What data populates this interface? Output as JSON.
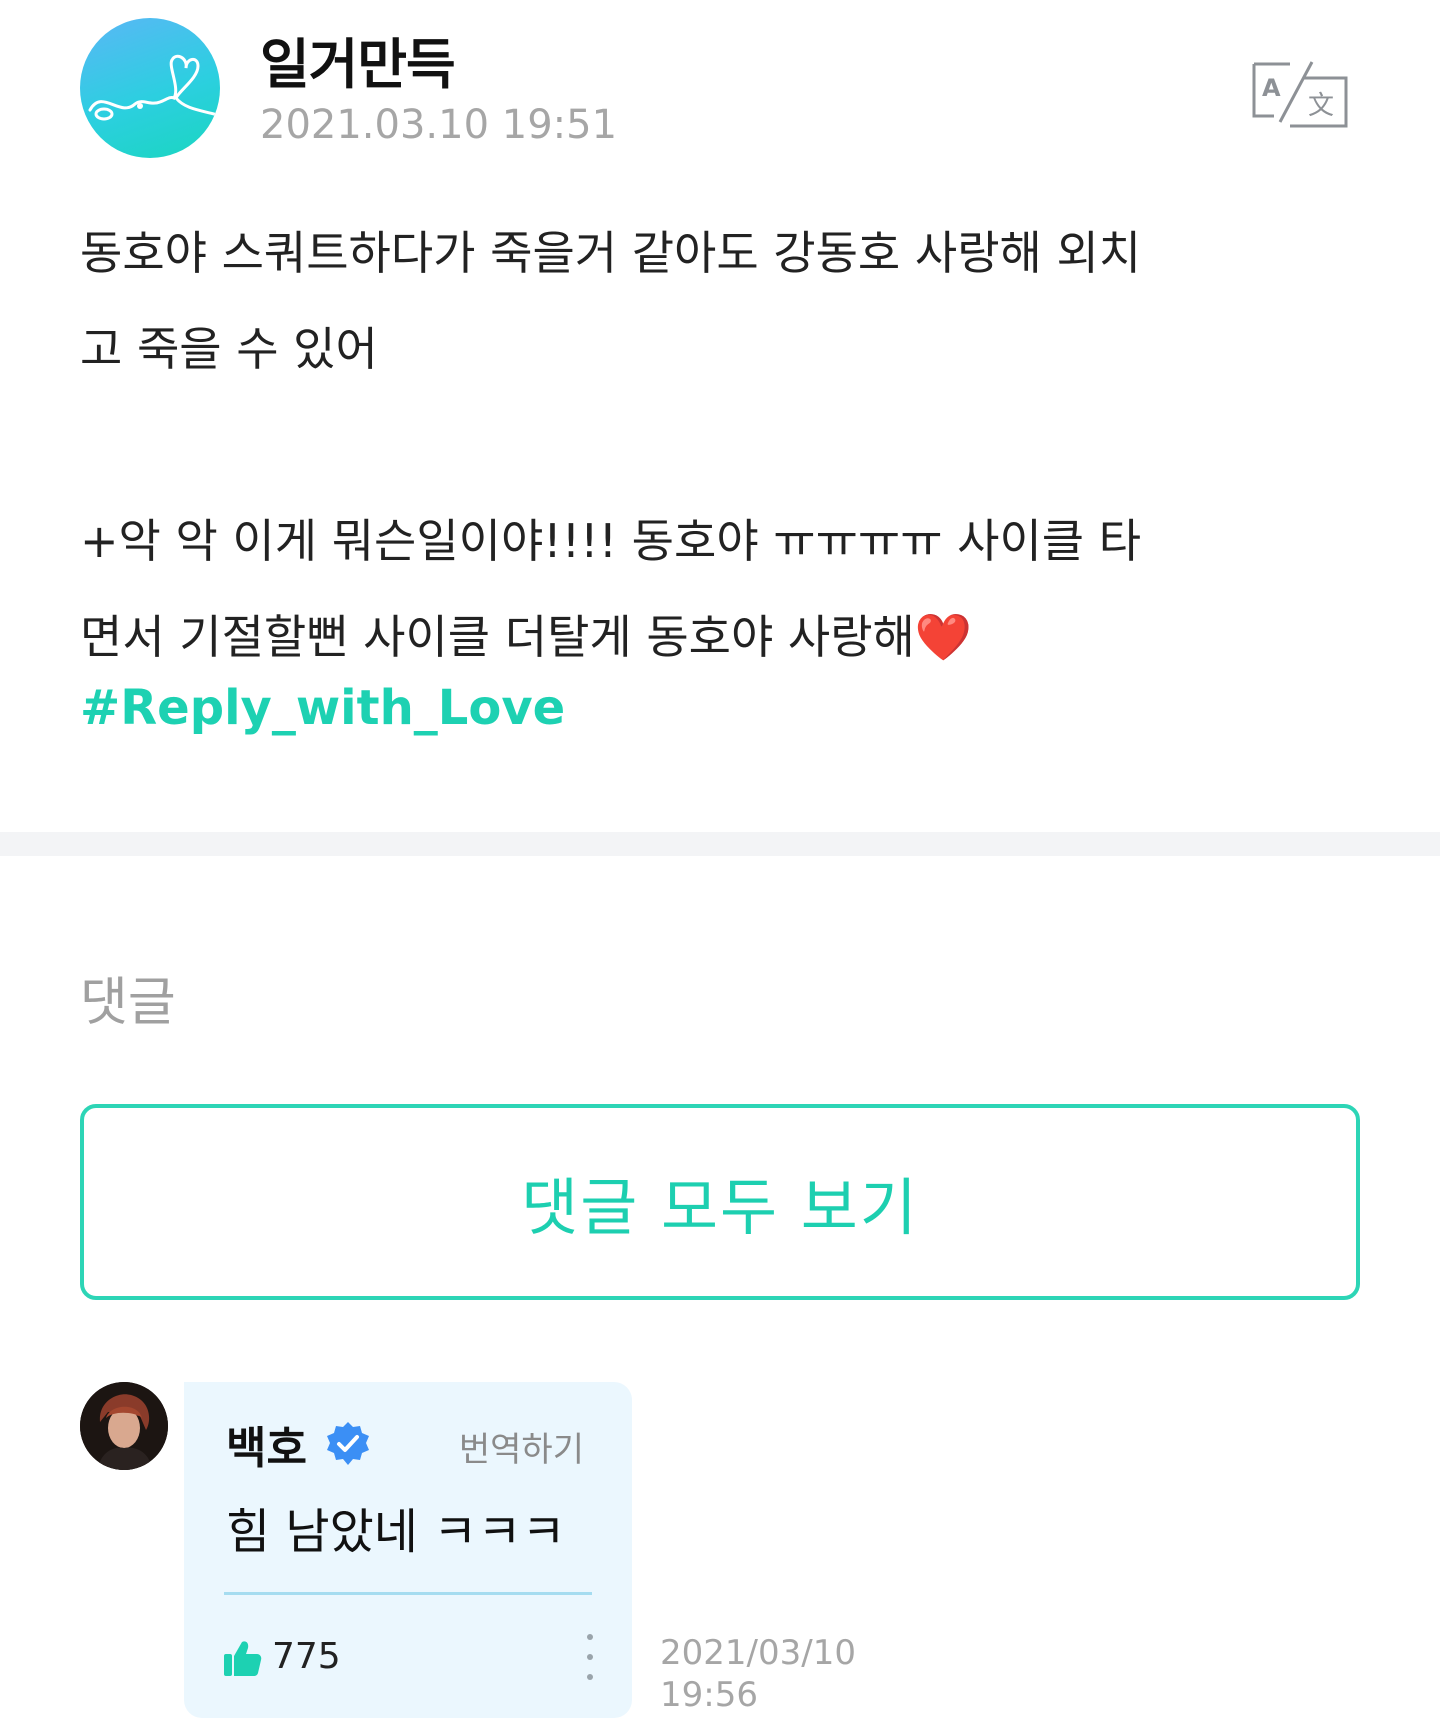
{
  "post": {
    "author": "일거만득",
    "date": "2021.03.10 19:51",
    "body": {
      "line1": "동호야 스쿼트하다가 죽을거 같아도 강동호 사랑해 외치",
      "line2": "고 죽을 수 있어",
      "line3": "+악 악 이게 뭐슨일이야!!!! 동호야 ㅠㅠㅠㅠ 사이클 타",
      "line4": "면서 기절할뻔 사이클 더탈게 동호야 사랑해❤️"
    },
    "hashtag": "#Reply_with_Love",
    "icons": {
      "avatar": "heart-ribbon-avatar-icon",
      "translate": "translate-icon"
    }
  },
  "comments_section": {
    "label": "댓글",
    "view_all_label": "댓글 모두 보기"
  },
  "comment": {
    "author": "백호",
    "verified": true,
    "translate_label": "번역하기",
    "text": "힘 남았네 ㅋㅋㅋ",
    "likes": "775",
    "date_line1": "2021/03/10",
    "date_line2": "19:56"
  },
  "colors": {
    "accent": "#1dd1b2",
    "bubble_bg": "#ebf7fe",
    "verified": "#3b8ff5",
    "muted_text": "#a6a6a6"
  }
}
